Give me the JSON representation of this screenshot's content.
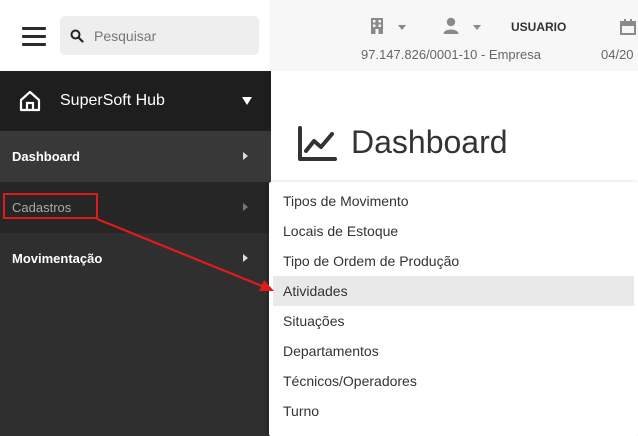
{
  "search": {
    "placeholder": "Pesquisar"
  },
  "header": {
    "username": "USUARIO",
    "company": "97.147.826/0001-10 - Empresa",
    "date": "04/20"
  },
  "sidebar": {
    "brand": "SuperSoft Hub",
    "items": [
      {
        "label": "Dashboard"
      },
      {
        "label": "Cadastros"
      },
      {
        "label": "Movimentação"
      }
    ]
  },
  "main": {
    "title": "Dashboard"
  },
  "dropdown": {
    "items": [
      "Tipos de Movimento",
      "Locais de Estoque",
      "Tipo de Ordem de Produção",
      "Atividades",
      "Situações",
      "Departamentos",
      "Técnicos/Operadores",
      "Turno"
    ],
    "highlighted": "Atividades"
  },
  "colors": {
    "annotation": "#e01b1b",
    "sidebar_bg": "#2f2f2f"
  },
  "icons": [
    "menu-icon",
    "search-icon",
    "building-icon",
    "user-icon",
    "calendar-icon",
    "home-icon",
    "chart-line-icon"
  ]
}
